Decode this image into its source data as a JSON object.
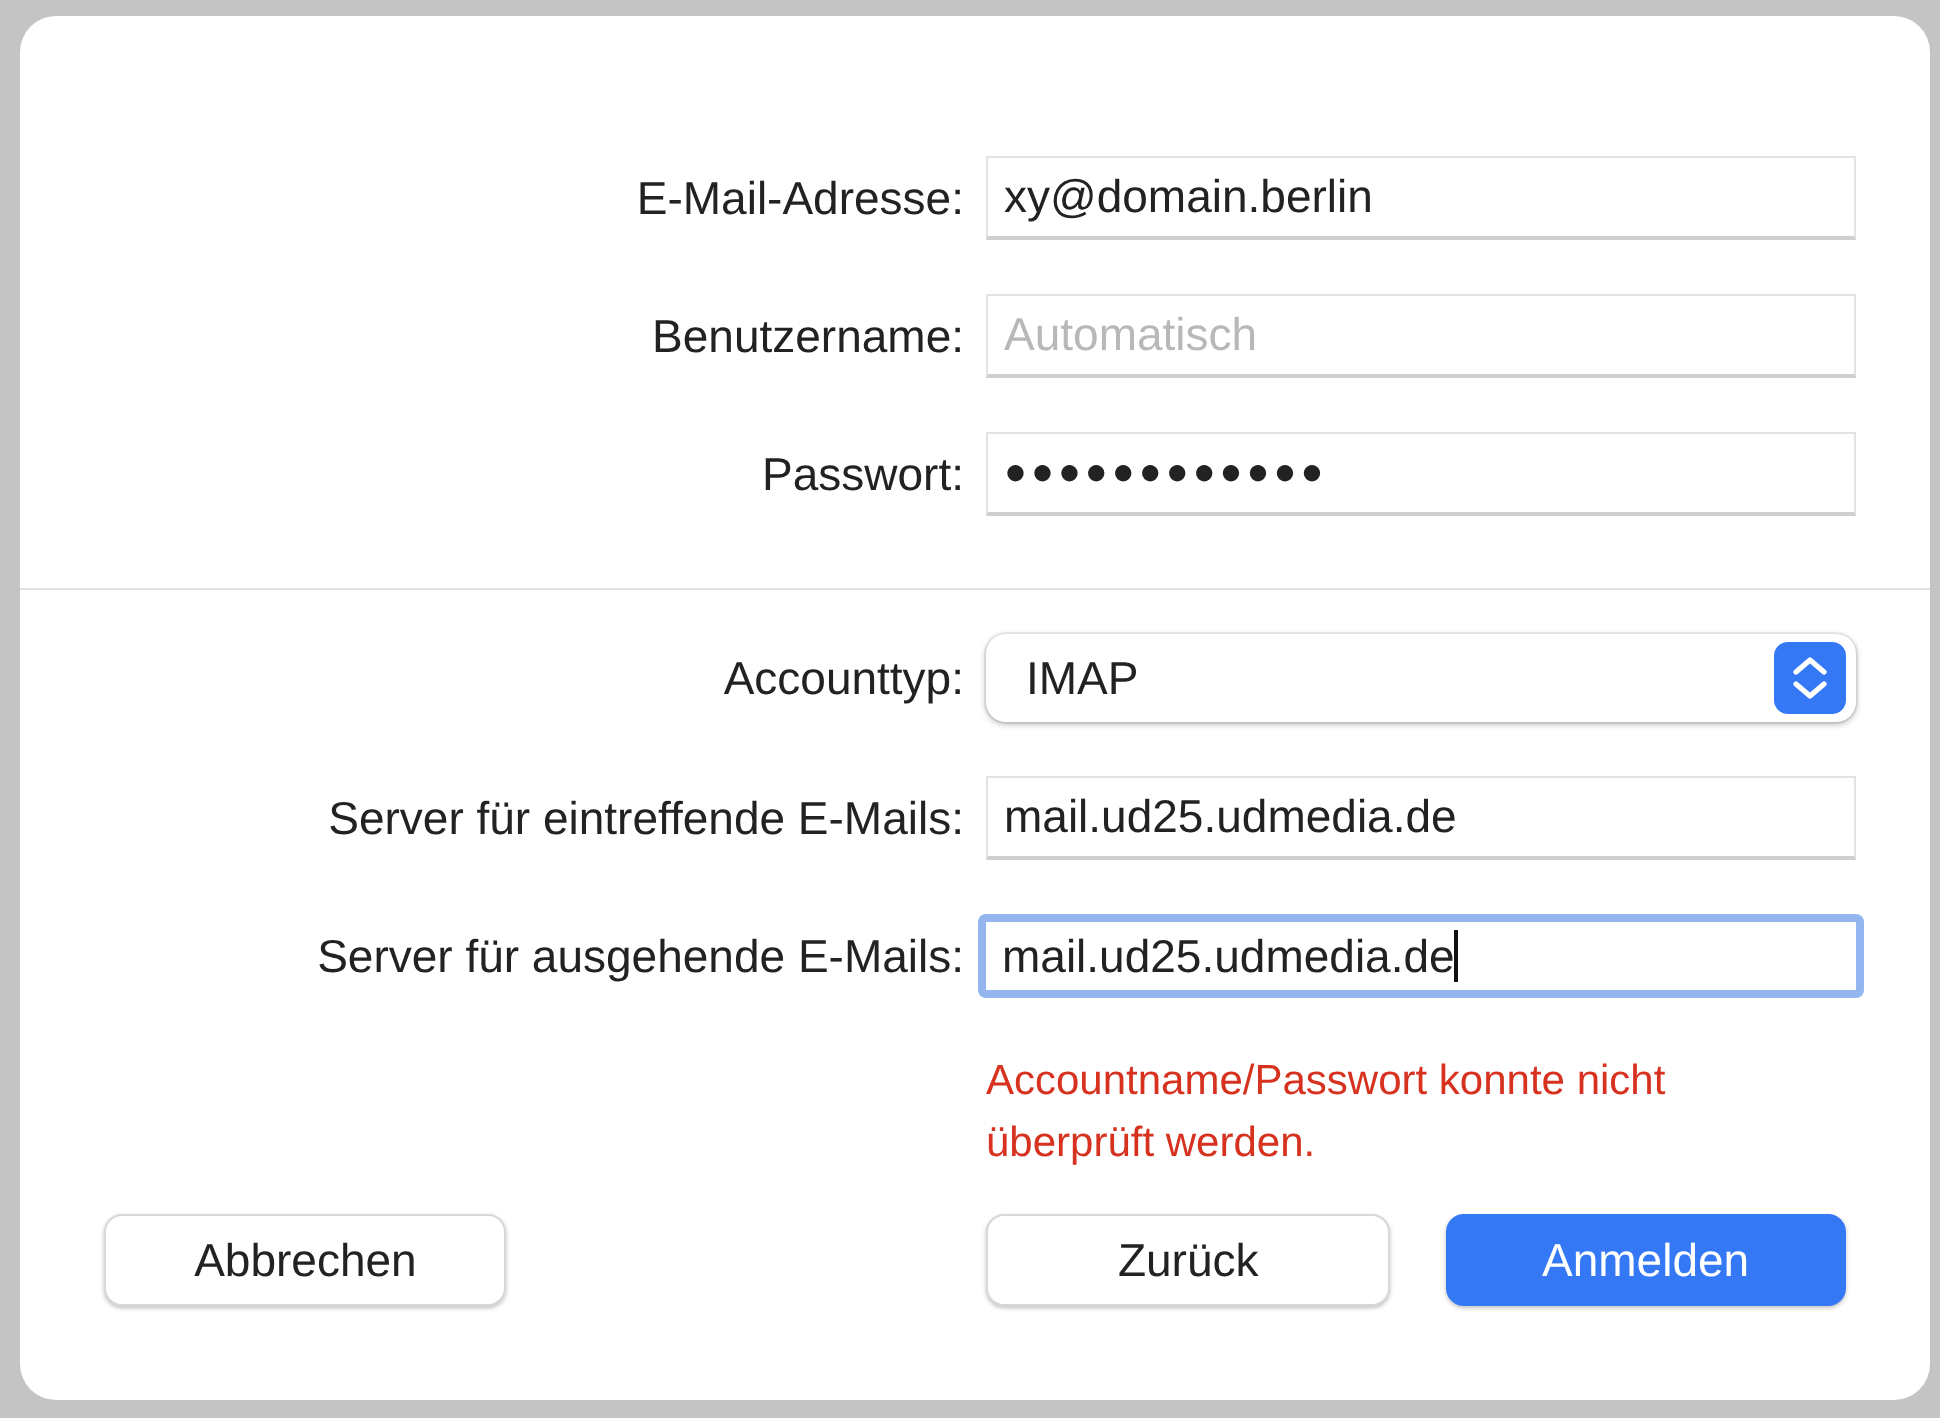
{
  "account_fields": [
    {
      "label": "E-Mail-Adresse:",
      "kind": "text",
      "value": "xy@domain.berlin",
      "focused": false
    },
    {
      "label": "Benutzername:",
      "kind": "text",
      "placeholder": "Automatisch",
      "focused": false
    },
    {
      "label": "Passwort:",
      "kind": "password",
      "value": "●●●●●●●●●●●●",
      "focused": false
    }
  ],
  "server_fields": [
    {
      "label": "Accounttyp:",
      "kind": "select",
      "value": "IMAP"
    },
    {
      "label": "Server für eintreffende E-Mails:",
      "kind": "text",
      "value": "mail.ud25.udmedia.de",
      "focused": false
    },
    {
      "label": "Server für ausgehende E-Mails:",
      "kind": "text",
      "value": "mail.ud25.udmedia.de",
      "focused": true
    }
  ],
  "error": "Accountname/Passwort konnte nicht überprüft werden.",
  "buttons": [
    {
      "label": "Abbrechen",
      "primary": false
    },
    {
      "label": "Zurück",
      "primary": false
    },
    {
      "label": "Anmelden",
      "primary": true
    }
  ]
}
